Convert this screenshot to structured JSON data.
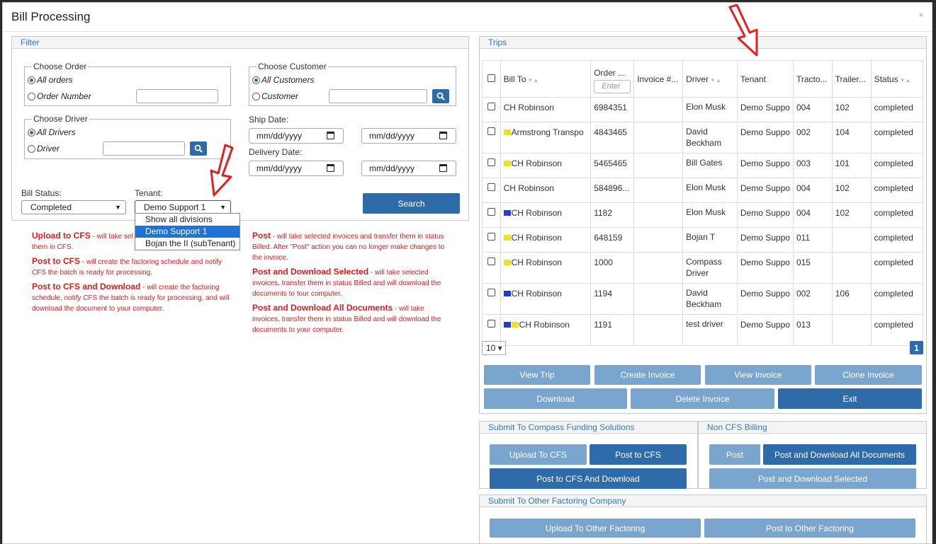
{
  "dialog": {
    "title": "Bill Processing",
    "close": "×"
  },
  "filter": {
    "title": "Filter",
    "order": {
      "legend": "Choose Order",
      "all": "All orders",
      "number": "Order Number"
    },
    "driver": {
      "legend": "Choose Driver",
      "all": "All Drivers",
      "driver": "Driver"
    },
    "customer": {
      "legend": "Choose Customer",
      "all": "All Customers",
      "customer": "Customer"
    },
    "ship_date": {
      "label": "Ship Date:",
      "placeholder": "mm/dd/yyyy"
    },
    "delivery_date": {
      "label": "Delivery Date:",
      "placeholder": "mm/dd/yyyy"
    },
    "bill_status": {
      "label": "Bill Status:",
      "value": "Completed"
    },
    "tenant": {
      "label": "Tenant:",
      "value": "Demo Support 1",
      "options": [
        "Show all divisions",
        "Demo Support 1",
        "Bojan the II (subTenant)"
      ]
    },
    "search_label": "Search"
  },
  "help_left": [
    {
      "title": "Upload to CFS",
      "text": " - will take sel",
      "text2": "them in CFS."
    },
    {
      "title": "Post to CFS",
      "text": " - will create the factoring schedule and notify CFS the batch is ready for processing."
    },
    {
      "title": "Post to CFS and Download",
      "text": " - will create the factoring schedule, notify CFS the batch is ready for processing, and will download the document to your computer."
    }
  ],
  "help_right": [
    {
      "title": "Post",
      "text": " - will take selected invoices and transfer them in status Billed. After \"Post\" action you can no longer make changes to the invoice."
    },
    {
      "title": "Post and Download Selected",
      "text": " - will take selected invoices, transfer them in status Billed and will download the documents to tour computer."
    },
    {
      "title": "Post and Download All Documents",
      "text": " - will take invoices, transfer them in status Billed and will download the documents to your computer."
    }
  ],
  "trips": {
    "title": "Trips",
    "order_placeholder": "Enter",
    "columns": [
      "Bill To",
      "Order ...",
      "Invoice #...",
      "Driver",
      "Tenant",
      "Tracto...",
      "Trailer...",
      "Status"
    ],
    "rows": [
      {
        "bill_to": "CH Robinson",
        "flags": "",
        "order": "6984351",
        "invoice": "",
        "driver": "Elon Musk",
        "tenant": "Demo Suppo",
        "tractor": "004",
        "trailer": "102",
        "status": "completed"
      },
      {
        "bill_to": "Armstrong Transpo",
        "flags": "y",
        "order": "4843465",
        "invoice": "",
        "driver": "David Beckham",
        "tenant": "Demo Suppo",
        "tractor": "002",
        "trailer": "104",
        "status": "completed"
      },
      {
        "bill_to": "CH Robinson",
        "flags": "y",
        "order": "5465465",
        "invoice": "",
        "driver": "Bill Gates",
        "tenant": "Demo Suppo",
        "tractor": "003",
        "trailer": "101",
        "status": "completed"
      },
      {
        "bill_to": "CH Robinson",
        "flags": "",
        "order": "584896...",
        "invoice": "",
        "driver": "Elon Musk",
        "tenant": "Demo Suppo",
        "tractor": "004",
        "trailer": "102",
        "status": "completed"
      },
      {
        "bill_to": "CH Robinson",
        "flags": "b",
        "order": "1182",
        "invoice": "",
        "driver": "Elon Musk",
        "tenant": "Demo Suppo",
        "tractor": "004",
        "trailer": "102",
        "status": "completed"
      },
      {
        "bill_to": "CH Robinson",
        "flags": "y",
        "order": "648159",
        "invoice": "",
        "driver": "Bojan T",
        "tenant": "Demo Suppo",
        "tractor": "011",
        "trailer": "",
        "status": "completed"
      },
      {
        "bill_to": "CH Robinson",
        "flags": "y",
        "order": "1000",
        "invoice": "",
        "driver": "Compass Driver",
        "tenant": "Demo Suppo",
        "tractor": "015",
        "trailer": "",
        "status": "completed"
      },
      {
        "bill_to": "CH Robinson",
        "flags": "b",
        "order": "1194",
        "invoice": "",
        "driver": "David Beckham",
        "tenant": "Demo Suppo",
        "tractor": "002",
        "trailer": "106",
        "status": "completed"
      },
      {
        "bill_to": "CH Robinson",
        "flags": "by",
        "order": "1191",
        "invoice": "",
        "driver": "test  driver",
        "tenant": "Demo Suppo",
        "tractor": "013",
        "trailer": "",
        "status": "completed"
      }
    ],
    "page_size": "10 ▾",
    "page": "1",
    "buttons": {
      "view_trip": "View Trip",
      "create_invoice": "Create Invoice",
      "view_invoice": "View Invoice",
      "clone_invoice": "Clone Invoice",
      "download": "Download",
      "delete_invoice": "Delete Invoice",
      "exit": "Exit"
    }
  },
  "cfs": {
    "title": "Submit To Compass Funding Solutions",
    "upload": "Upload To CFS",
    "post": "Post to CFS",
    "post_download": "Post to CFS And Download"
  },
  "noncfs": {
    "title": "Non CFS Billing",
    "post": "Post",
    "post_download_all": "Post and Download All Documents",
    "post_download_selected": "Post and Download Selected"
  },
  "other": {
    "title": "Submit To Other Factoring Company",
    "upload": "Upload To Other Factoring",
    "post": "Post to Other Factoring"
  },
  "colors": {
    "accent": "#2f6ba8",
    "accent_light": "#7aa5cf",
    "help_text": "#e01b1b",
    "arrow": "#e02020"
  }
}
